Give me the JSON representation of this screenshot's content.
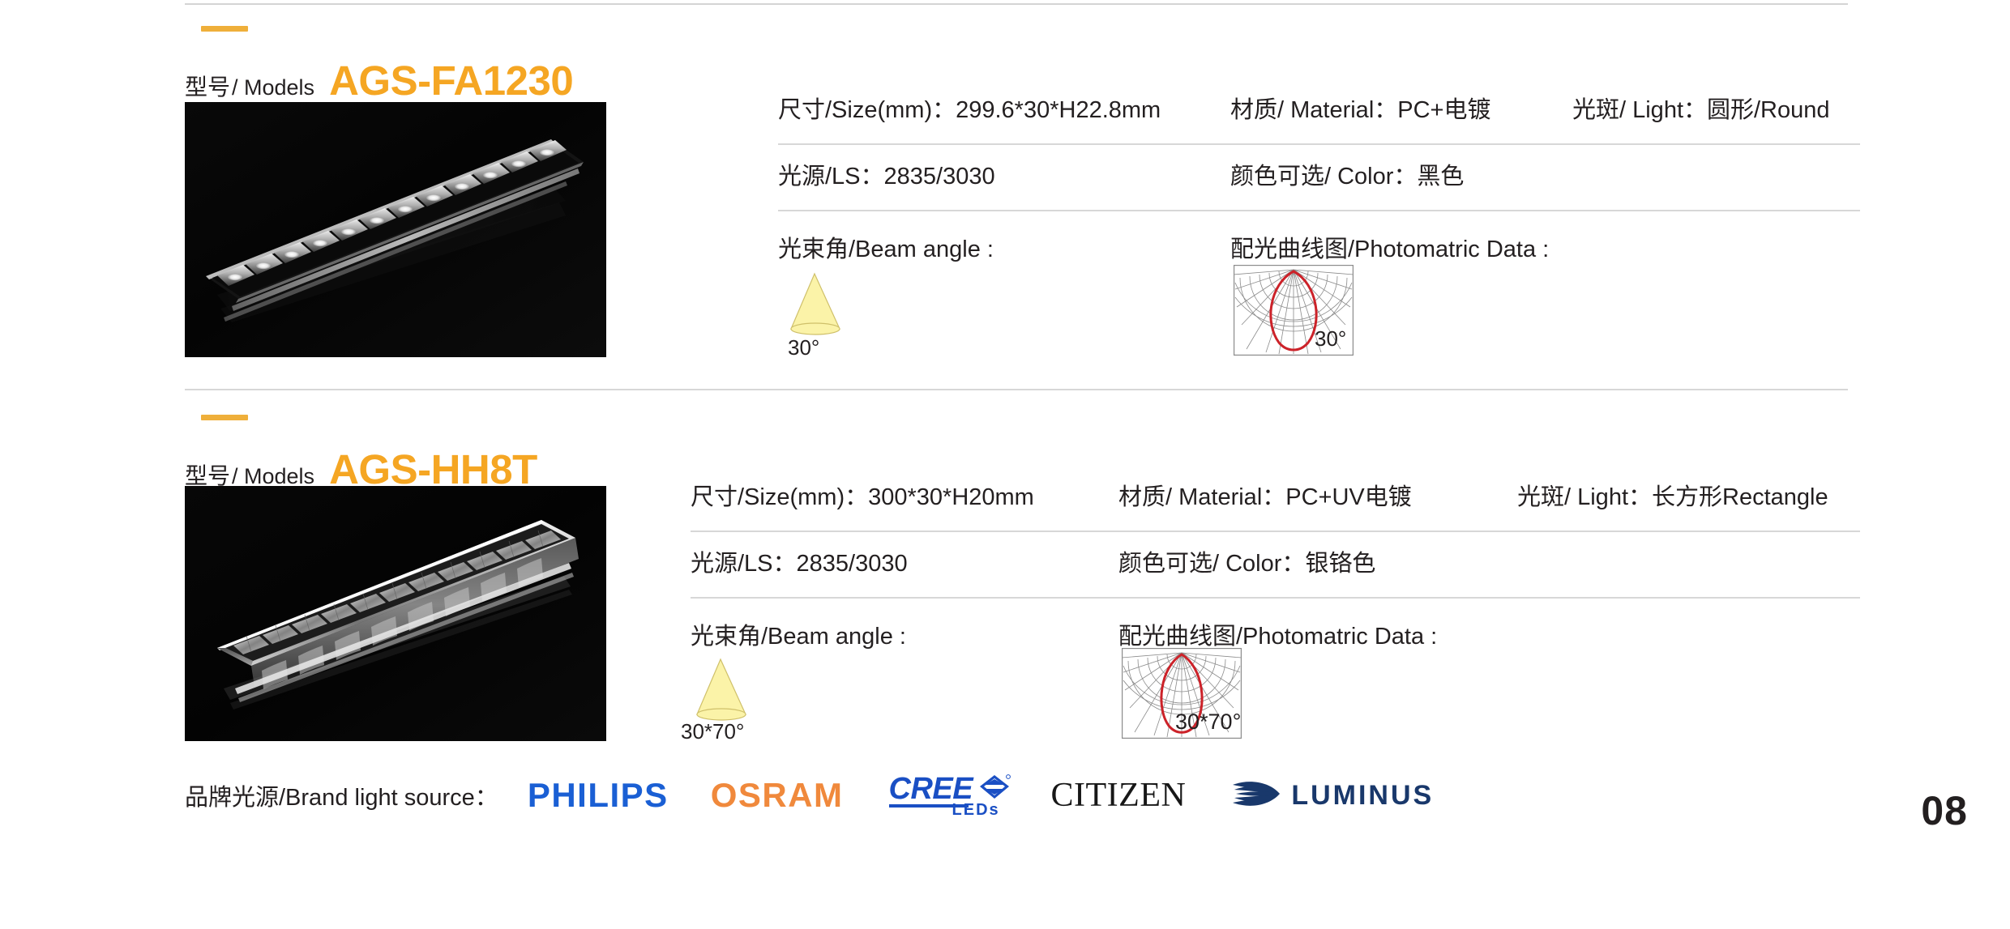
{
  "page": {
    "number": "08",
    "accent_color": "#f5a623",
    "dash_color": "#efaf3a",
    "rule_color": "#d7d7d7",
    "text_color": "#231f20"
  },
  "labels": {
    "model_cn": "型号",
    "model_sep": "/ Models",
    "size_label": "尺寸/Size(mm)：",
    "material_label": "材质/ Material：",
    "light_label": "光斑/ Light：",
    "ls_label": "光源/LS：",
    "color_label": "颜色可选/ Color：",
    "beam_angle_title": "光束角/Beam angle :",
    "photometric_title": "配光曲线图/Photomatric Data :"
  },
  "products": [
    {
      "id": "ags-fa1230",
      "model_code": "AGS-FA1230",
      "photo_alt": "black linear LED grille downlight bar with twelve reflector cells",
      "size": "299.6*30*H22.8mm",
      "material": "PC+电镀",
      "light": "圆形/Round",
      "light_source": "2835/3030",
      "color": "黑色",
      "beam_angle": "30°",
      "photometric_angle": "30°"
    },
    {
      "id": "ags-hh8t",
      "model_code": "AGS-HH8T",
      "photo_alt": "silver chrome linear LED grille downlight bar with faceted reflectors",
      "size": "300*30*H20mm",
      "material": "PC+UV电镀",
      "light": "长方形Rectangle",
      "light_source": "2835/3030",
      "color": "银铬色",
      "beam_angle": "30*70°",
      "photometric_angle": "30*70°"
    }
  ],
  "brands": {
    "label": "品牌光源/Brand light source：",
    "items": [
      {
        "name": "PHILIPS",
        "color": "#1a5fd4"
      },
      {
        "name": "OSRAM",
        "color": "#f0893c"
      },
      {
        "name": "CREE",
        "sub": "LEDs",
        "color": "#1a4fc4"
      },
      {
        "name": "CITIZEN",
        "color": "#171717"
      },
      {
        "name": "LUMINUS",
        "color": "#19386b"
      }
    ]
  }
}
